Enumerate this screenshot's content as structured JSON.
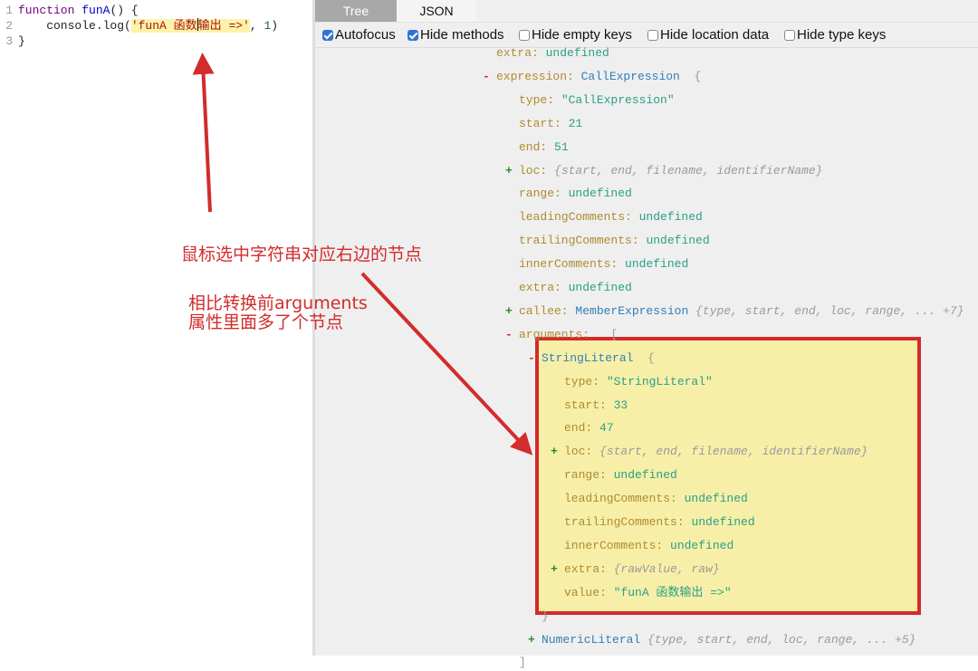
{
  "editor": {
    "lines": [
      {
        "num": "1",
        "tokens": [
          {
            "t": "kw",
            "text": "function "
          },
          {
            "t": "fn",
            "text": "funA"
          },
          {
            "t": "plain",
            "text": "() {"
          }
        ]
      },
      {
        "num": "2",
        "tokens": [
          {
            "t": "plain",
            "text": "    console.log("
          },
          {
            "t": "str",
            "text": "'funA 函数"
          },
          {
            "t": "cursor",
            "text": ""
          },
          {
            "t": "str",
            "text": "输出 =>'"
          },
          {
            "t": "plain",
            "text": ", "
          },
          {
            "t": "num",
            "text": "1"
          },
          {
            "t": "plain",
            "text": ")"
          }
        ]
      },
      {
        "num": "3",
        "tokens": [
          {
            "t": "plain",
            "text": "}"
          }
        ]
      }
    ]
  },
  "tabs": [
    {
      "label": "Tree",
      "active": true
    },
    {
      "label": "JSON",
      "active": false
    }
  ],
  "options": [
    {
      "label": "Autofocus",
      "checked": true
    },
    {
      "label": "Hide methods",
      "checked": true
    },
    {
      "label": "Hide empty keys",
      "checked": false
    },
    {
      "label": "Hide location data",
      "checked": false
    },
    {
      "label": "Hide type keys",
      "checked": false
    }
  ],
  "tree": {
    "rows": [
      {
        "indent": 0,
        "toggle": "",
        "key": "extra",
        "value": "undefined",
        "vtype": "und"
      },
      {
        "indent": -1,
        "toggle": "-",
        "key": "expression",
        "typeName": "CallExpression",
        "open": "{"
      },
      {
        "indent": 1,
        "toggle": "",
        "key": "type",
        "value": "\"CallExpression\"",
        "vtype": "str"
      },
      {
        "indent": 1,
        "toggle": "",
        "key": "start",
        "value": "21",
        "vtype": "num"
      },
      {
        "indent": 1,
        "toggle": "",
        "key": "end",
        "value": "51",
        "vtype": "num"
      },
      {
        "indent": 1,
        "toggle": "+",
        "key": "loc",
        "summary": "{start, end, filename, identifierName}"
      },
      {
        "indent": 1,
        "toggle": "",
        "key": "range",
        "value": "undefined",
        "vtype": "und"
      },
      {
        "indent": 1,
        "toggle": "",
        "key": "leadingComments",
        "value": "undefined",
        "vtype": "und"
      },
      {
        "indent": 1,
        "toggle": "",
        "key": "trailingComments",
        "value": "undefined",
        "vtype": "und"
      },
      {
        "indent": 1,
        "toggle": "",
        "key": "innerComments",
        "value": "undefined",
        "vtype": "und"
      },
      {
        "indent": 1,
        "toggle": "",
        "key": "extra",
        "value": "undefined",
        "vtype": "und"
      },
      {
        "indent": 1,
        "toggle": "+",
        "key": "callee",
        "typeName": "MemberExpression",
        "summary": "{type, start, end, loc, range, ... +7}"
      },
      {
        "indent": 1,
        "toggle": "-",
        "key": "arguments",
        "open": "["
      },
      {
        "indent": 2,
        "toggle": "-",
        "key": "",
        "typeName": "StringLiteral",
        "open": "{"
      },
      {
        "indent": 3,
        "toggle": "",
        "key": "type",
        "value": "\"StringLiteral\"",
        "vtype": "str"
      },
      {
        "indent": 3,
        "toggle": "",
        "key": "start",
        "value": "33",
        "vtype": "num"
      },
      {
        "indent": 3,
        "toggle": "",
        "key": "end",
        "value": "47",
        "vtype": "num"
      },
      {
        "indent": 3,
        "toggle": "+",
        "key": "loc",
        "summary": "{start, end, filename, identifierName}"
      },
      {
        "indent": 3,
        "toggle": "",
        "key": "range",
        "value": "undefined",
        "vtype": "und"
      },
      {
        "indent": 3,
        "toggle": "",
        "key": "leadingComments",
        "value": "undefined",
        "vtype": "und"
      },
      {
        "indent": 3,
        "toggle": "",
        "key": "trailingComments",
        "value": "undefined",
        "vtype": "und"
      },
      {
        "indent": 3,
        "toggle": "",
        "key": "innerComments",
        "value": "undefined",
        "vtype": "und"
      },
      {
        "indent": 3,
        "toggle": "+",
        "key": "extra",
        "summary": "{rawValue, raw}"
      },
      {
        "indent": 3,
        "toggle": "",
        "key": "value",
        "value": "\"funA 函数输出 =>\"",
        "vtype": "str"
      },
      {
        "indent": 2.5,
        "toggle": "",
        "key": "",
        "close": "}"
      },
      {
        "indent": 2,
        "toggle": "+",
        "key": "",
        "typeName": "NumericLiteral",
        "summary": "{type, start, end, loc, range, ... +5}"
      },
      {
        "indent": 1.5,
        "toggle": "",
        "key": "",
        "close": "]"
      }
    ]
  },
  "annotations": {
    "note1": "鼠标选中字符串对应右边的节点",
    "note2_line1": "相比转换前arguments",
    "note2_line2": "属性里面多了个节点"
  },
  "colors": {
    "annotation_red": "#d22c2c",
    "highlight_fill": "#f7efa8",
    "checkbox_blue": "#2f74d0"
  }
}
